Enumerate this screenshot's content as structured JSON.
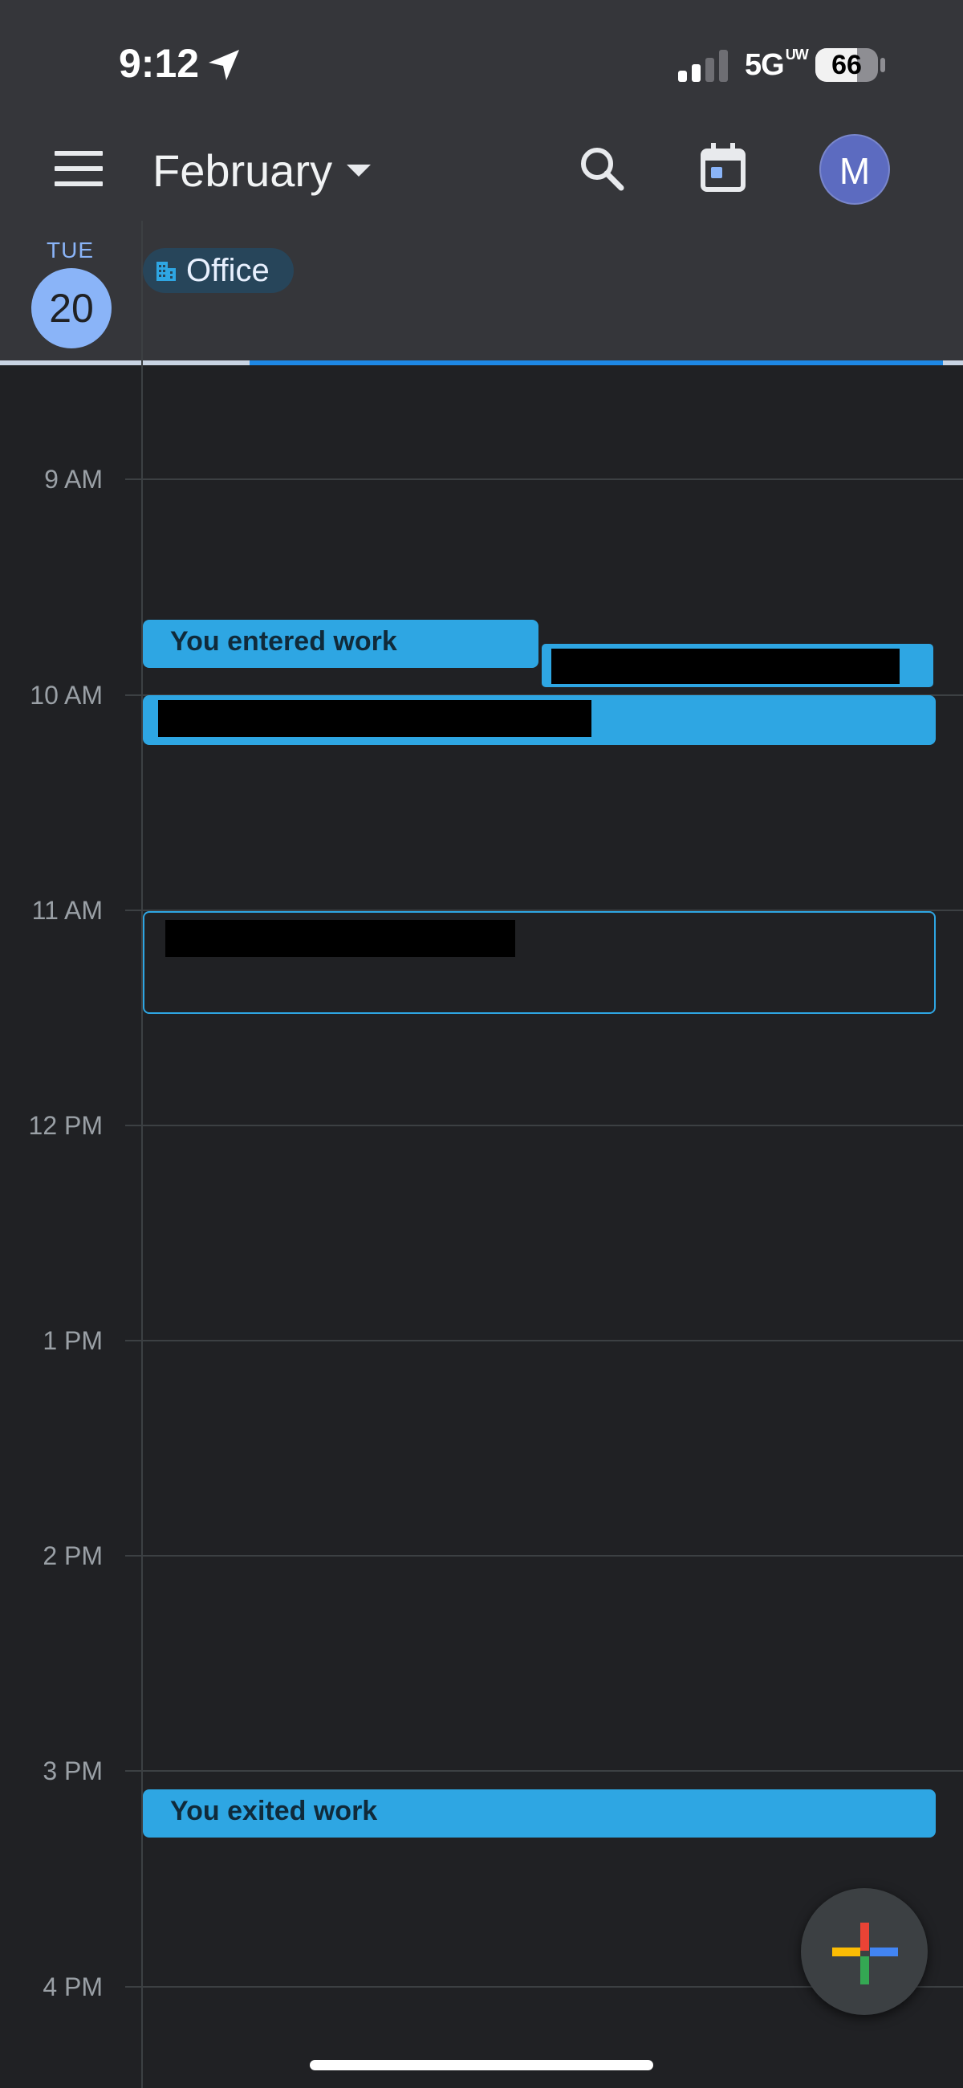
{
  "status_bar": {
    "time": "9:12",
    "network": "5G",
    "network_suffix": "UW",
    "battery": "66"
  },
  "header": {
    "month": "February",
    "avatar_letter": "M"
  },
  "day": {
    "weekday": "TUE",
    "date": "20"
  },
  "all_day_chip": {
    "label": "Office",
    "icon": "building-icon"
  },
  "hours": [
    "9 AM",
    "10 AM",
    "11 AM",
    "12 PM",
    "1 PM",
    "2 PM",
    "3 PM",
    "4 PM"
  ],
  "events": {
    "entered_work": "You entered work",
    "exited_work": "You exited work"
  },
  "colors": {
    "accent": "#8ab4f8",
    "event": "#2ea6e3",
    "avatar": "#5c6bc0",
    "background": "#202124",
    "header": "#35363a"
  }
}
